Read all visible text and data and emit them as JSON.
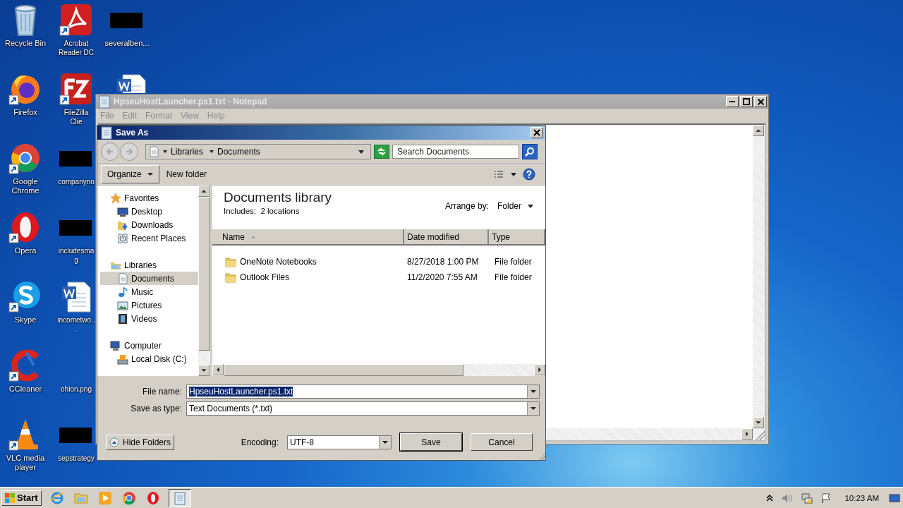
{
  "desktop": {
    "icons": [
      {
        "label": "Recycle Bin",
        "kind": "recycle-bin"
      },
      {
        "label": "Firefox",
        "kind": "firefox"
      },
      {
        "label": "Google Chrome",
        "kind": "chrome"
      },
      {
        "label": "Opera",
        "kind": "opera"
      },
      {
        "label": "Skype",
        "kind": "skype"
      },
      {
        "label": "CCleaner",
        "kind": "ccleaner"
      },
      {
        "label": "VLC media player",
        "kind": "vlc"
      },
      {
        "label": "Acrobat Reader DC",
        "kind": "acrobat"
      },
      {
        "label": "FileZilla Clie",
        "kind": "filezilla"
      },
      {
        "label": "companyno",
        "kind": "redacted"
      },
      {
        "label": "includesmag",
        "kind": "redacted"
      },
      {
        "label": "incometwo...",
        "kind": "word"
      },
      {
        "label": "ohion.png",
        "kind": "blank"
      },
      {
        "label": "sepstrategy",
        "kind": "redacted"
      },
      {
        "label": "severalben...",
        "kind": "redacted"
      },
      {
        "kind": "word"
      }
    ]
  },
  "notepad": {
    "title": "HpseuHostLauncher.ps1.txt - Notepad",
    "menu": [
      "File",
      "Edit",
      "Format",
      "View",
      "Help"
    ]
  },
  "save_as": {
    "title": "Save As",
    "breadcrumb": [
      "Libraries",
      "Documents"
    ],
    "search": {
      "placeholder": "Search Documents"
    },
    "toolbar": {
      "organize": "Organize",
      "new_folder": "New folder"
    },
    "nav": [
      {
        "label": "Favorites",
        "kind": "star",
        "selected": false,
        "children": [
          {
            "label": "Desktop",
            "kind": "monitor",
            "selected": false
          },
          {
            "label": "Downloads",
            "kind": "downloads",
            "selected": false
          },
          {
            "label": "Recent Places",
            "kind": "recent",
            "selected": false
          }
        ]
      },
      {
        "label": "Libraries",
        "kind": "library",
        "selected": false,
        "children": [
          {
            "label": "Documents",
            "kind": "document",
            "selected": true
          },
          {
            "label": "Music",
            "kind": "music",
            "selected": false
          },
          {
            "label": "Pictures",
            "kind": "pictures",
            "selected": false
          },
          {
            "label": "Videos",
            "kind": "videos",
            "selected": false
          }
        ]
      },
      {
        "label": "Computer",
        "kind": "computer",
        "selected": false,
        "children": [
          {
            "label": "Local Disk (C:)",
            "kind": "disk",
            "selected": false
          }
        ]
      }
    ],
    "library": {
      "title": "Documents library",
      "includes": "Includes:  2 locations",
      "arrange_label": "Arrange by:",
      "arrange_value": "Folder"
    },
    "columns": [
      {
        "label": "Name",
        "sorted": true
      },
      {
        "label": "Date modified",
        "sorted": false
      },
      {
        "label": "Type",
        "sorted": false
      }
    ],
    "rows": [
      {
        "name": "OneNote Notebooks",
        "date": "8/27/2018 1:00 PM",
        "type": "File folder",
        "selected": false
      },
      {
        "name": "Outlook Files",
        "date": "11/2/2020 7:55 AM",
        "type": "File folder",
        "selected": false
      }
    ],
    "file_name": {
      "label": "File name:",
      "value": "HpseuHostLauncher.ps1.txt",
      "highlighted": true
    },
    "save_type": {
      "label": "Save as type:",
      "value": "Text Documents (*.txt)"
    },
    "hide_folders": "Hide Folders",
    "encoding": {
      "label": "Encoding:",
      "value": "UTF-8"
    },
    "buttons": [
      "Save",
      "Cancel"
    ]
  },
  "taskbar": {
    "start": "Start",
    "apps": [
      {
        "kind": "ie",
        "active": false
      },
      {
        "kind": "explorer",
        "active": false
      },
      {
        "kind": "media",
        "active": false
      },
      {
        "kind": "chrome",
        "active": false
      },
      {
        "kind": "opera",
        "active": false
      },
      {
        "kind": "notepad",
        "active": true
      }
    ],
    "clock": "10:23 AM"
  }
}
